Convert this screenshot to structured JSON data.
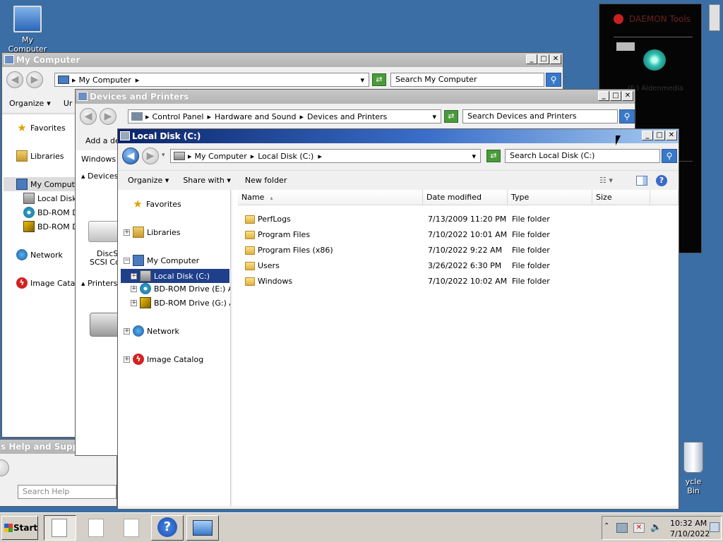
{
  "desktop": {
    "icons": [
      {
        "label": "My Computer"
      },
      {
        "label": "ycle Bin"
      }
    ]
  },
  "daemon": {
    "title": "DAEMON Tools",
    "item": "(F:) Aidenmedia"
  },
  "help_window": {
    "title": "s Help and Support",
    "search_placeholder": "Search Help"
  },
  "mycomputer_window": {
    "title": "My Computer",
    "address": "My Computer",
    "search": "Search My Computer",
    "toolbar": [
      "Organize",
      "Ur"
    ],
    "nav": [
      "Favorites",
      "Libraries",
      "My Compute",
      "Local Disk",
      "BD-ROM D",
      "BD-ROM D",
      "Network",
      "Image Catalo"
    ]
  },
  "devices_window": {
    "title": "Devices and Printers",
    "breadcrumb": [
      "Control Panel",
      "Hardware and Sound",
      "Devices and Printers"
    ],
    "search": "Search Devices and Printers",
    "toolbar": "Add a de",
    "windows_label": "Windows c",
    "groups": [
      "Devices",
      "Printers"
    ],
    "device_label": "DiscS",
    "device_label2": "SCSI Co"
  },
  "localdisk_window": {
    "title": "Local Disk (C:)",
    "breadcrumb": [
      "My Computer",
      "Local Disk (C:)"
    ],
    "search": "Search Local Disk (C:)",
    "toolbar": {
      "organize": "Organize",
      "share": "Share with",
      "newfolder": "New folder"
    },
    "nav": {
      "favorites": "Favorites",
      "libraries": "Libraries",
      "mycomputer": "My Computer",
      "localdisk": "Local Disk (C:)",
      "bd_e": "BD-ROM Drive (E:) Aid",
      "bd_g": "BD-ROM Drive (G:) Aic",
      "network": "Network",
      "catalog": "Image Catalog"
    },
    "columns": [
      "Name",
      "Date modified",
      "Type",
      "Size"
    ],
    "files": [
      {
        "name": "PerfLogs",
        "date": "7/13/2009 11:20 PM",
        "type": "File folder"
      },
      {
        "name": "Program Files",
        "date": "7/10/2022 10:01 AM",
        "type": "File folder"
      },
      {
        "name": "Program Files (x86)",
        "date": "7/10/2022 9:22 AM",
        "type": "File folder"
      },
      {
        "name": "Users",
        "date": "3/26/2022 6:30 PM",
        "type": "File folder"
      },
      {
        "name": "Windows",
        "date": "7/10/2022 10:02 AM",
        "type": "File folder"
      }
    ]
  },
  "taskbar": {
    "start": "Start",
    "time": "10:32 AM",
    "date": "7/10/2022"
  }
}
